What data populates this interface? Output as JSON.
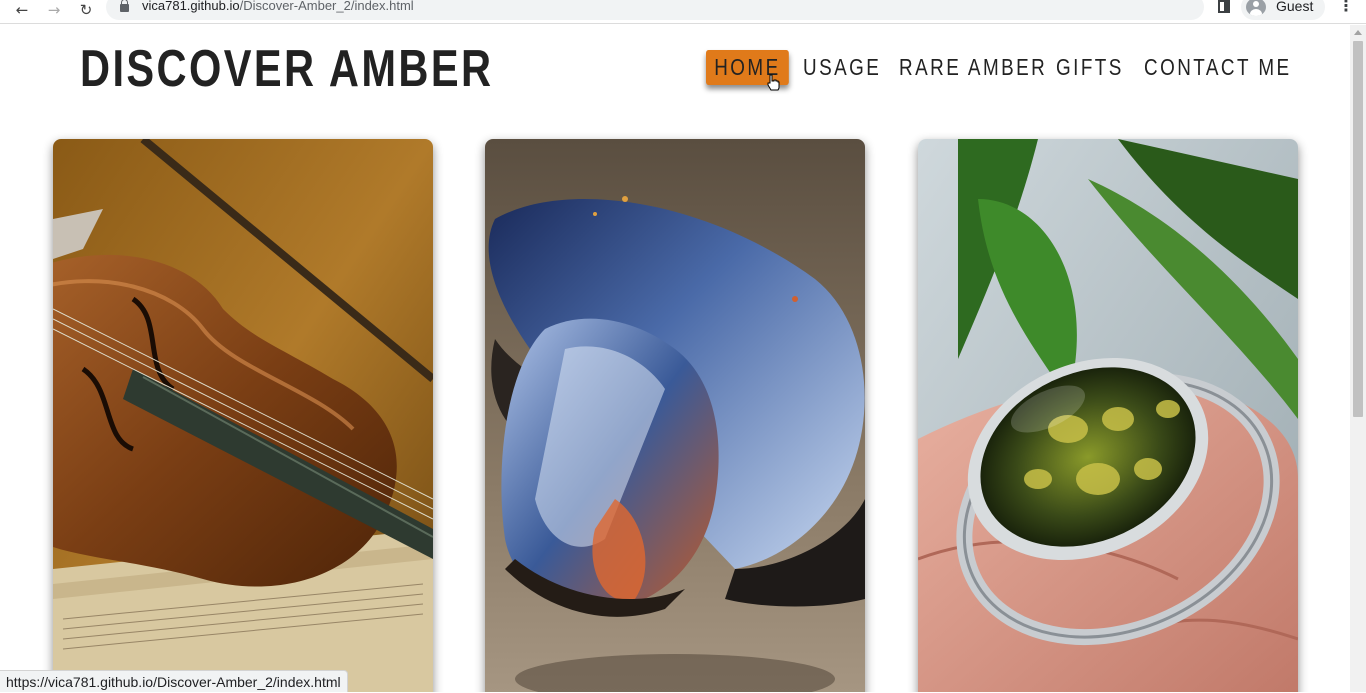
{
  "browser": {
    "back_icon": "arrow-left-icon",
    "forward_icon": "arrow-right-icon",
    "reload_icon": "reload-icon",
    "url_host": "vica781.github.io",
    "url_path": "/Discover-Amber_2/index.html",
    "profile_label": "Guest",
    "status_url": "https://vica781.github.io/Discover-Amber_2/index.html"
  },
  "site": {
    "title": "DISCOVER AMBER",
    "accent_color": "#e07a1a"
  },
  "nav": {
    "items": [
      {
        "label": "HOME",
        "active": true
      },
      {
        "label": "USAGE",
        "active": false
      },
      {
        "label": "RARE AMBER",
        "active": false
      },
      {
        "label": "GIFTS",
        "active": false
      },
      {
        "label": "CONTACT ME",
        "active": false
      }
    ]
  },
  "cards": [
    {
      "image": "violin-photo"
    },
    {
      "image": "blue-amber-photo"
    },
    {
      "image": "amber-ring-photo"
    }
  ]
}
